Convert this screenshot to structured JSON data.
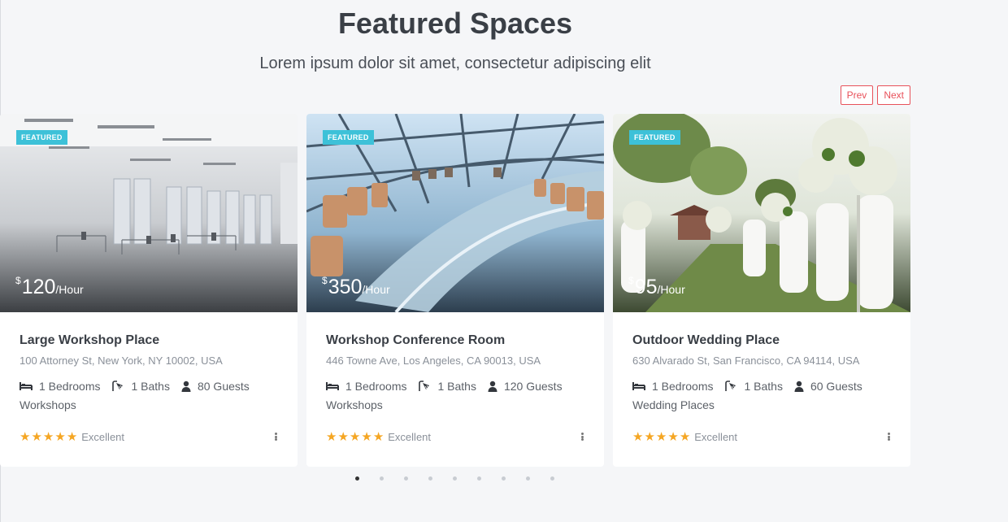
{
  "section": {
    "title": "Featured Spaces",
    "subtitle": "Lorem ipsum dolor sit amet, consectetur adipiscing elit"
  },
  "nav": {
    "prev": "Prev",
    "next": "Next"
  },
  "cards": [
    {
      "badge": "FEATURED",
      "currency": "$",
      "price": "120",
      "unit": "/Hour",
      "name": "Large Workshop Place",
      "address": "100 Attorney St, New York, NY 10002, USA",
      "bedrooms": "1 Bedrooms",
      "baths": "1 Baths",
      "guests": "80 Guests",
      "category": "Workshops",
      "stars": 5,
      "rating": "Excellent"
    },
    {
      "badge": "FEATURED",
      "currency": "$",
      "price": "350",
      "unit": "/Hour",
      "name": "Workshop Conference Room",
      "address": "446 Towne Ave, Los Angeles, CA 90013, USA",
      "bedrooms": "1 Bedrooms",
      "baths": "1 Baths",
      "guests": "120 Guests",
      "category": "Workshops",
      "stars": 5,
      "rating": "Excellent"
    },
    {
      "badge": "FEATURED",
      "currency": "$",
      "price": "95",
      "unit": "/Hour",
      "name": "Outdoor Wedding Place",
      "address": "630 Alvarado St, San Francisco, CA 94114, USA",
      "bedrooms": "1 Bedrooms",
      "baths": "1 Baths",
      "guests": "60 Guests",
      "category": "Wedding Places",
      "stars": 5,
      "rating": "Excellent"
    }
  ],
  "icons": {
    "bed": "bed-icon",
    "bath": "shower-icon",
    "guests": "user-icon",
    "star": "star-icon",
    "more": "more-vertical-icon"
  },
  "pagination": {
    "count": 9,
    "active": 0
  },
  "colors": {
    "badge": "#3dc1d8",
    "accent": "#e8515a",
    "star": "#f5a623",
    "background": "#f5f6f8"
  }
}
